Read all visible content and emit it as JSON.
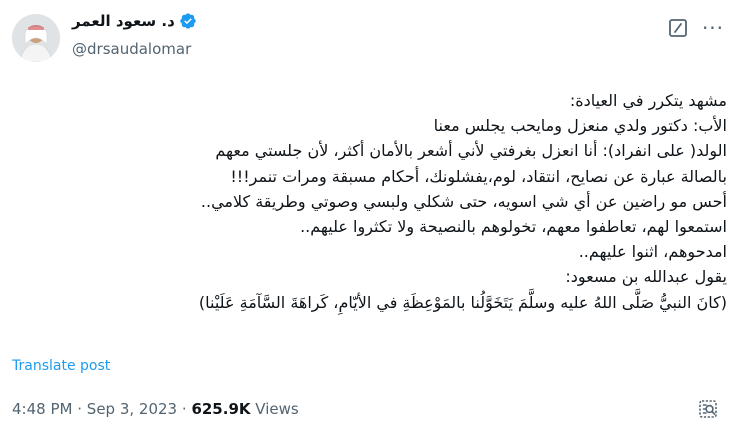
{
  "author": {
    "name": "د. سعود العمر",
    "handle": "@drsaudalomar",
    "verified": true
  },
  "tweet": {
    "lines": [
      "مشهد يتكرر في العيادة:",
      "الأب: دكتور ولدي منعزل ومايحب يجلس معنا",
      "الولد( على انفراد): أنا انعزل بغرفتي لأني أشعر بالأمان أكثر، لأن جلستي معهم",
      "بالصالة عبارة عن نصايح، انتقاد، لوم،يفشلونك، أحكام مسبقة ومرات تنمر!!!",
      "أحس مو راضين عن أي شي اسويه، حتى شكلي ولبسي وصوتي وطريقة كلامي..",
      "استمعوا لهم، تعاطفوا معهم، تخولوهم بالنصيحة ولا تكثروا عليهم..",
      "امدحوهم، اثنوا عليهم..",
      "يقول عبدالله بن مسعود:",
      "(كانَ النبيُّ صَلَّى اللهُ عليه وسلَّمَ يَتَخَوَّلُنا بالمَوْعِظَةِ في الأيّامِ، كَراهَةَ السَّآمَةِ عَلَيْنا)"
    ],
    "translate_label": "Translate post",
    "time": "4:48 PM",
    "separator": "·",
    "date": "Sep 3, 2023",
    "views_count": "625.9K",
    "views_label": "Views"
  },
  "icons": {
    "grok": "grok-icon",
    "more": "more-icon",
    "verified": "verified-badge-icon",
    "analytics": "analytics-icon"
  },
  "colors": {
    "link": "#1d9bf0",
    "muted": "#536471",
    "text": "#0f1419",
    "verified": "#1d9bf0"
  }
}
